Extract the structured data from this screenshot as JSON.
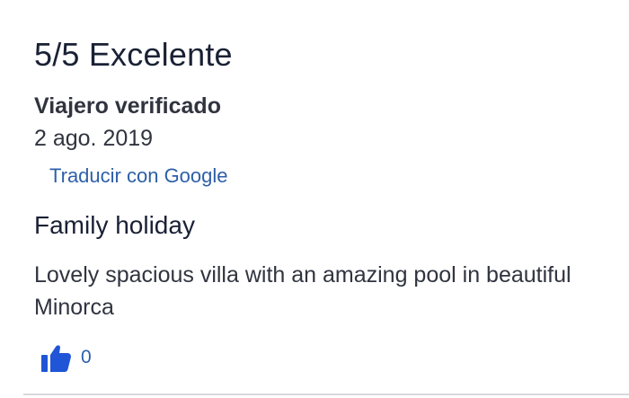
{
  "review": {
    "rating": "5/5 Excelente",
    "reviewer": "Viajero verificado",
    "date": "2 ago. 2019",
    "translate_link": "Traducir con Google",
    "title": "Family holiday",
    "body": "Lovely spacious villa with an amazing pool in beautiful Minorca",
    "helpful_icon": "thumbs-up-icon",
    "helpful_count": "0"
  },
  "colors": {
    "text_dark": "#1a2135",
    "text_body": "#30343f",
    "link": "#2d5fa8",
    "thumb": "#1f55d6",
    "divider": "#d9d9dc"
  }
}
